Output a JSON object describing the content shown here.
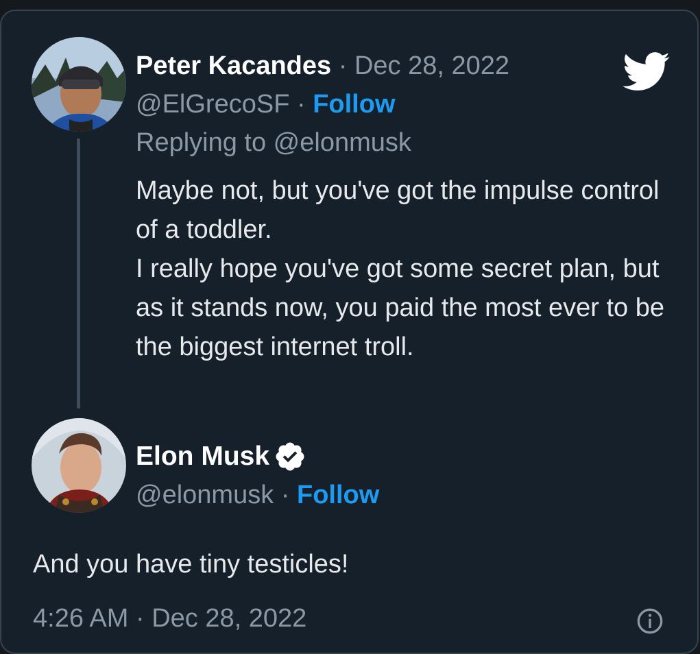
{
  "reply_tweet": {
    "author_name": "Peter Kacandes",
    "separator": "·",
    "date": "Dec 28, 2022",
    "handle": "@ElGrecoSF",
    "follow_label": "Follow",
    "replying_to": "Replying to @elonmusk",
    "body_lines": [
      "Maybe not, but you've got the impulse control of a toddler.",
      "I really hope you've got some secret plan, but as it stands now, you paid the most ever to be the biggest internet troll."
    ]
  },
  "main_tweet": {
    "author_name": "Elon Musk",
    "handle": "@elonmusk",
    "separator": "·",
    "follow_label": "Follow",
    "text": "And you have tiny testicles!",
    "time": "4:26 AM",
    "date": "Dec 28, 2022"
  },
  "icons": {
    "brand": "twitter-bird-icon",
    "verified": "verified-badge-icon",
    "info": "info-icon"
  },
  "colors": {
    "background": "#15202b",
    "text": "#e7e9ea",
    "secondary_text": "#8b98a5",
    "follow": "#1d9bf0",
    "border": "#38444d"
  }
}
